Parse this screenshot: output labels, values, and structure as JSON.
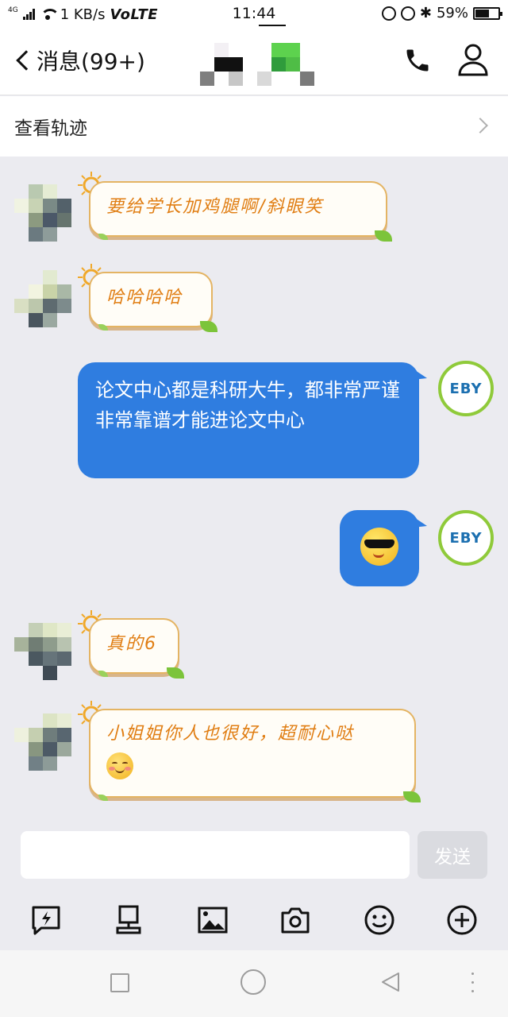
{
  "status_bar": {
    "network": "4G",
    "speed": "1 KB/s",
    "volte": "VoLTE",
    "time": "11:44",
    "battery_percent": "59%",
    "battery_level": 0.59
  },
  "header": {
    "back_label": "消息(99+)",
    "phone_icon": "phone-icon",
    "profile_icon": "contact-icon"
  },
  "track_row": {
    "label": "查看轨迹"
  },
  "messages": [
    {
      "side": "in",
      "text": "要给学长加鸡腿啊/斜眼笑"
    },
    {
      "side": "in",
      "text": "哈哈哈哈"
    },
    {
      "side": "out",
      "text": "论文中心都是科研大牛，都非常严谨非常靠谱才能进论文中心"
    },
    {
      "side": "out",
      "emoji": "cool-sunglasses-emoji"
    },
    {
      "side": "in",
      "text": "真的6"
    },
    {
      "side": "in",
      "text": "小姐姐你人也很好，超耐心哒"
    }
  ],
  "self_avatar_text": "EBY",
  "composer": {
    "placeholder": "",
    "send_label": "发送"
  },
  "toolbar": [
    "flash-chat-icon",
    "computer-icon",
    "image-icon",
    "camera-icon",
    "emoji-icon",
    "plus-icon"
  ],
  "colors": {
    "out_bubble": "#2f7de0",
    "in_text": "#e07d12",
    "chat_bg": "#ebebf0"
  }
}
